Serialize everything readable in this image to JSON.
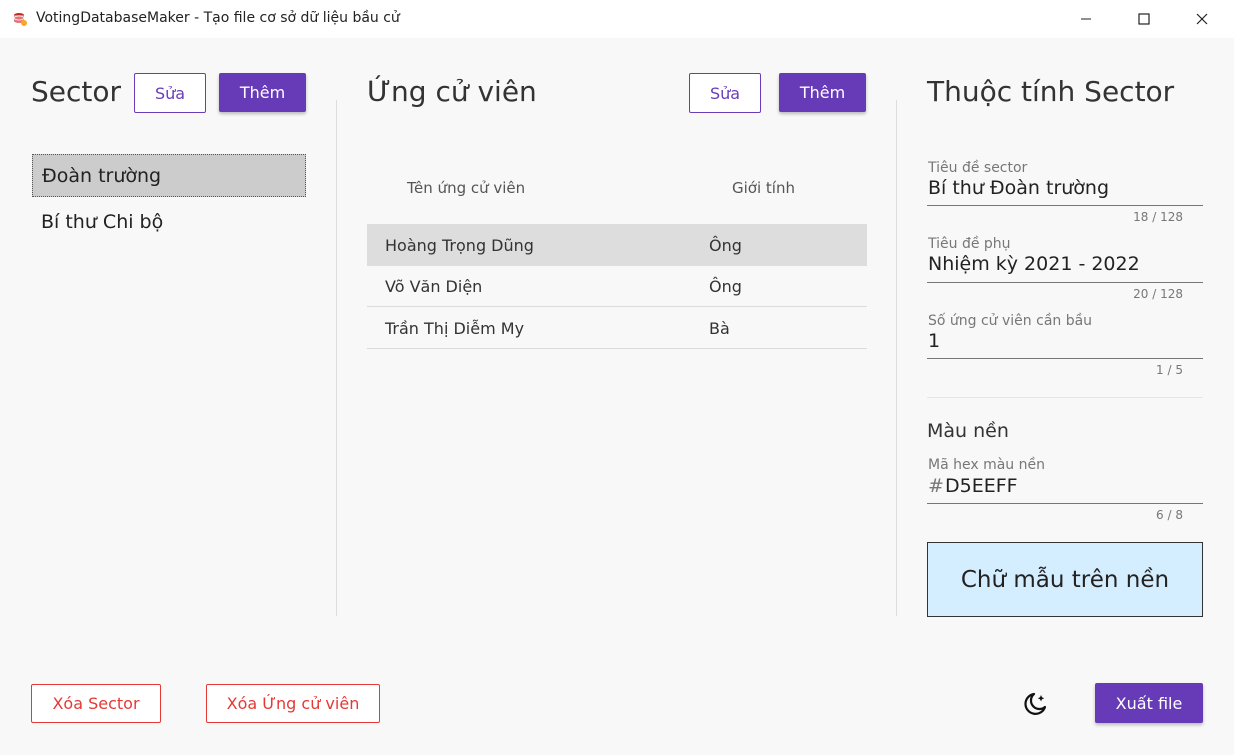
{
  "window": {
    "title": "VotingDatabaseMaker - Tạo file cơ sở dữ liệu bầu cử"
  },
  "sector_panel": {
    "heading": "Sector",
    "edit_label": "Sửa",
    "add_label": "Thêm",
    "items": [
      "Đoàn trường",
      "Bí thư Chi bộ"
    ],
    "selected_index": 0
  },
  "candidates_panel": {
    "heading": "Ứng cử viên",
    "edit_label": "Sửa",
    "add_label": "Thêm",
    "columns": [
      "Tên ứng cử viên",
      "Giới tính"
    ],
    "rows": [
      {
        "name": "Hoàng Trọng Dũng",
        "gender": "Ông"
      },
      {
        "name": "Võ Văn Diện",
        "gender": "Ông"
      },
      {
        "name": "Trần Thị Diễm My",
        "gender": "Bà"
      }
    ],
    "selected_index": 0
  },
  "properties_panel": {
    "heading": "Thuộc tính Sector",
    "title_field": {
      "label": "Tiêu đề sector",
      "value": "Bí thư Đoàn trường",
      "counter": "18 / 128"
    },
    "subtitle_field": {
      "label": "Tiêu đề phụ",
      "value": "Nhiệm kỳ 2021 - 2022",
      "counter": "20 / 128"
    },
    "count_field": {
      "label": "Số ứng cử viên cần bầu",
      "value": "1",
      "counter": "1 / 5"
    },
    "bg_section": "Màu nền",
    "hex_field": {
      "label": "Mã hex màu nền",
      "prefix": "#",
      "value": "D5EEFF",
      "counter": "6 / 8"
    },
    "preview_text": "Chữ mẫu trên nền",
    "preview_color": "#d5eeff"
  },
  "footer": {
    "delete_sector_label": "Xóa Sector",
    "delete_candidate_label": "Xóa Ứng cử viên",
    "export_label": "Xuất file"
  },
  "colors": {
    "accent": "#673ab7",
    "danger": "#e53935"
  },
  "icons": [
    "database-icon",
    "minimize-icon",
    "maximize-icon",
    "close-icon",
    "dark-mode-icon"
  ]
}
